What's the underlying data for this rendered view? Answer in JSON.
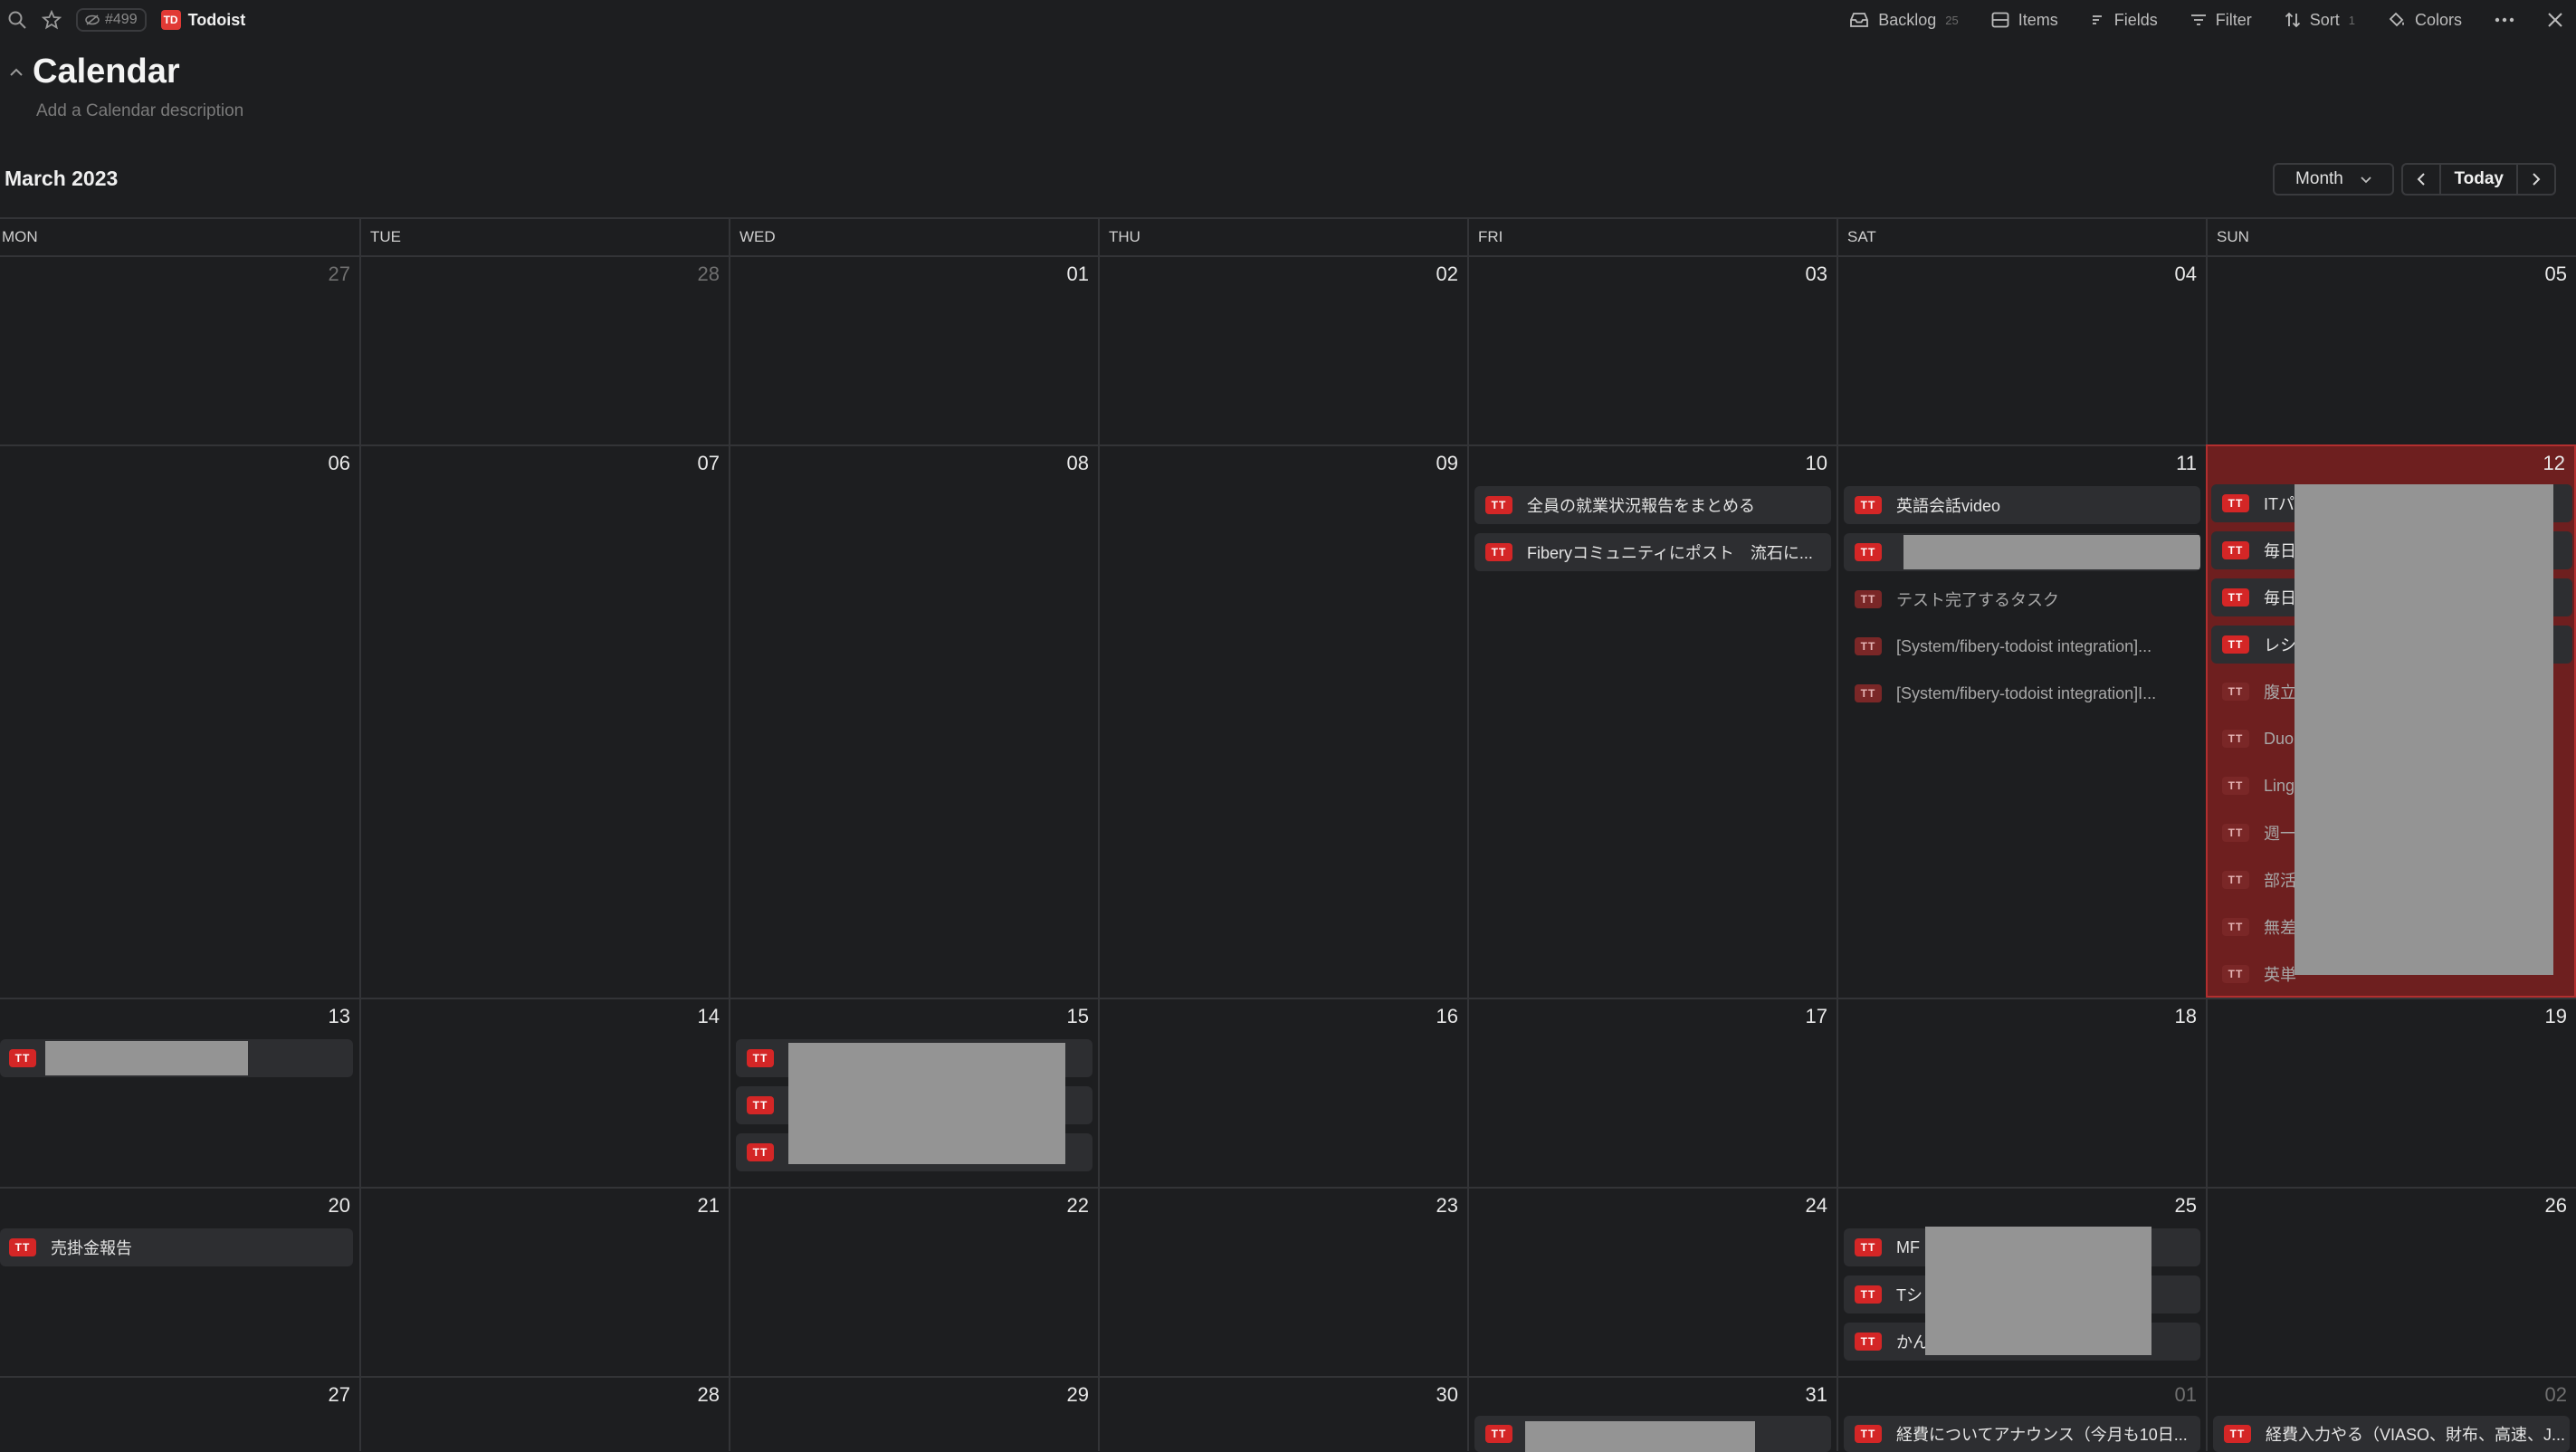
{
  "toolbar": {
    "count_badge": "#499",
    "app_name": "Todoist",
    "app_logo": "TD",
    "backlog_label": "Backlog",
    "backlog_count": "25",
    "items_label": "Items",
    "fields_label": "Fields",
    "filter_label": "Filter",
    "sort_label": "Sort",
    "sort_count": "1",
    "colors_label": "Colors"
  },
  "page": {
    "title": "Calendar",
    "description_placeholder": "Add a Calendar description"
  },
  "calendar": {
    "month_label": "March 2023",
    "view_mode": "Month",
    "today_label": "Today",
    "weekdays": [
      "MON",
      "TUE",
      "WED",
      "THU",
      "FRI",
      "SAT",
      "SUN"
    ],
    "event_badge": "TT",
    "days": {
      "w0": [
        "27",
        "28",
        "01",
        "02",
        "03",
        "04",
        "05"
      ],
      "w1": [
        "06",
        "07",
        "08",
        "09",
        "10",
        "11",
        "12"
      ],
      "w2": [
        "13",
        "14",
        "15",
        "16",
        "17",
        "18",
        "19"
      ],
      "w3": [
        "20",
        "21",
        "22",
        "23",
        "24",
        "25",
        "26"
      ],
      "w4": [
        "27",
        "28",
        "29",
        "30",
        "31",
        "01",
        "02"
      ]
    },
    "events": {
      "fri10": [
        "全員の就業状況報告をまとめる",
        "Fiberyコミュニティにポスト　流石に..."
      ],
      "sat11": [
        "英語会話video",
        "",
        "テスト完了するタスク",
        "[System/fibery-todoist integration]...",
        "[System/fibery-todoist integration]I..."
      ],
      "sun12": [
        "ITパ",
        "毎日",
        "毎日",
        "レシ",
        "腹立",
        "Duo",
        "Ling",
        "週一",
        "部活",
        "無差",
        "英単"
      ],
      "mon13": [
        ""
      ],
      "wed15": [
        "",
        "",
        ""
      ],
      "mon20": [
        "売掛金報告"
      ],
      "sat25": [
        "MF",
        "Tシ",
        "かん"
      ],
      "fri31": [
        ""
      ],
      "sat01": [
        "経費についてアナウンス（今月も10日..."
      ],
      "sun02": [
        "経費入力やる（VIASO、財布、高速、J..."
      ]
    }
  }
}
